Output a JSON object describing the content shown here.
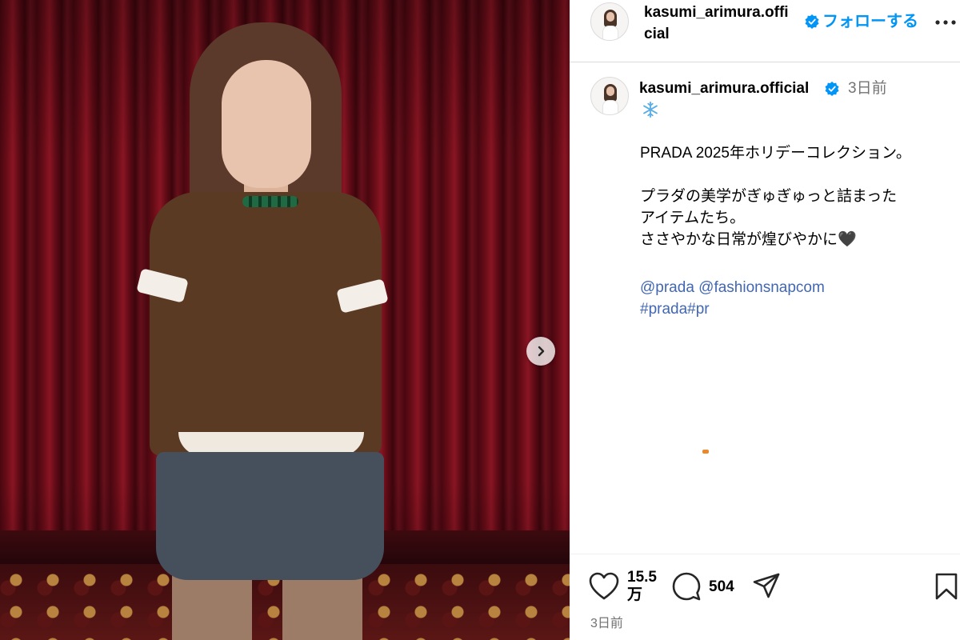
{
  "header": {
    "username": "kasumi_arimura.official",
    "follow_label": "フォローする"
  },
  "caption": {
    "username": "kasumi_arimura.official",
    "time": "3日前",
    "emoji": "❄️",
    "body": "PRADA 2025年ホリデーコレクション。\n\nプラダの美学がぎゅぎゅっと詰まった\nアイテムたち。\nささやかな日常が煌びやかに🖤",
    "mentions": [
      "@prada",
      "@fashionsnapcom"
    ],
    "hashtags": [
      "#prada",
      "#pr"
    ]
  },
  "footer": {
    "likes_line1": "15.5",
    "likes_line2": "万",
    "comments": "504",
    "post_time": "3日前"
  },
  "colors": {
    "accent_blue": "#0095f6",
    "link_blue": "#4267b2",
    "muted_gray": "#737373"
  },
  "icons": {
    "verified": "verified-badge-icon",
    "more": "more-horizontal-icon",
    "next": "chevron-right-icon",
    "like": "heart-outline-icon",
    "comment": "speech-bubble-icon",
    "share": "paper-plane-icon",
    "save": "bookmark-icon"
  }
}
